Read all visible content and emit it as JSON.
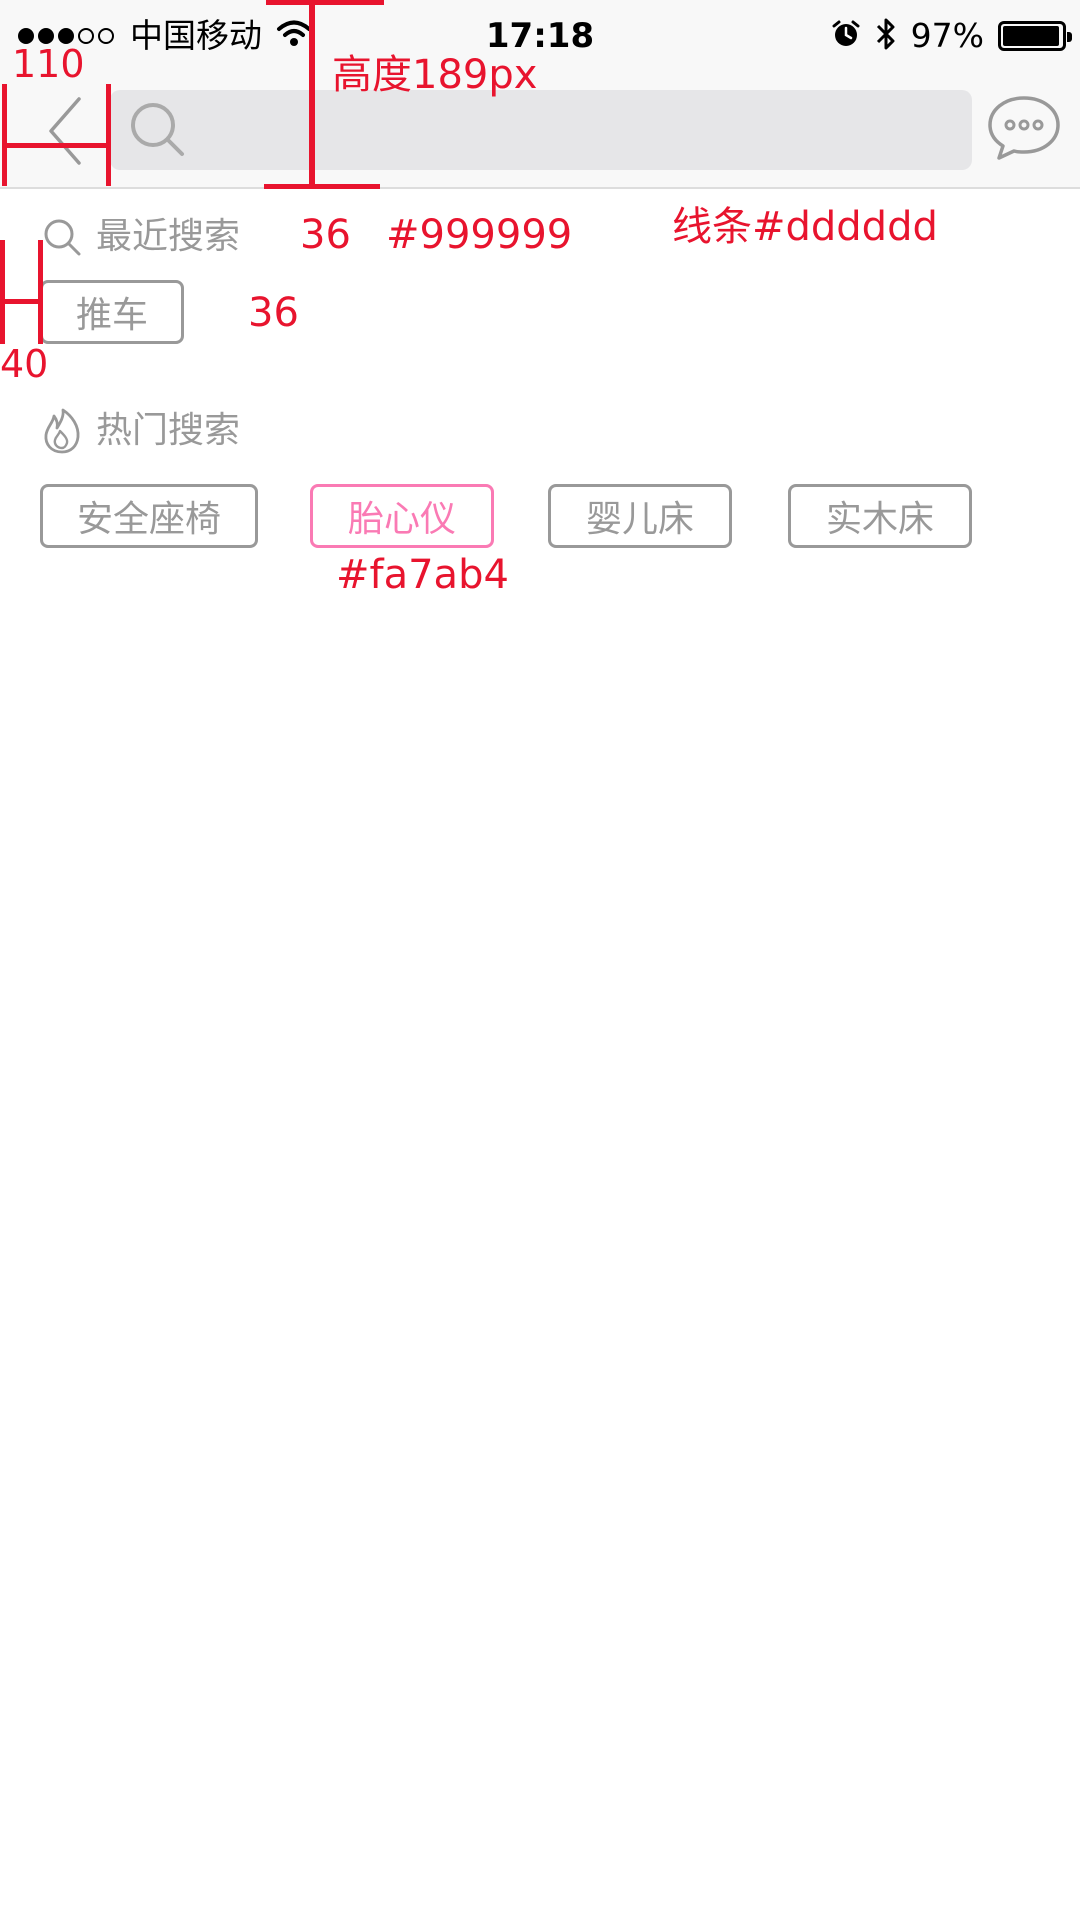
{
  "status_bar": {
    "carrier": "中国移动",
    "time": "17:18",
    "battery_percent": "97%",
    "battery_level": 0.97,
    "icons": [
      "signal-dots-icon",
      "wifi-icon",
      "alarm-icon",
      "bluetooth-icon",
      "battery-icon"
    ]
  },
  "header": {
    "icons": [
      "back-arrow-icon",
      "search-icon",
      "message-bubble-icon"
    ],
    "search_placeholder": ""
  },
  "recent": {
    "title": "最近搜索",
    "icon": "search-icon",
    "tags": [
      "推车"
    ]
  },
  "hot": {
    "title": "热门搜索",
    "icon": "flame-icon",
    "tags": [
      "安全座椅",
      "胎心仪",
      "婴儿床",
      "实木床"
    ],
    "active_tag": "胎心仪"
  },
  "annotations": {
    "back_width": "110",
    "header_height": "高度189px",
    "font_size_title": "36",
    "text_color": "#999999",
    "line_color": "线条#dddddd",
    "left_margin": "40",
    "font_size_tag": "36",
    "active_color": "#fa7ab4"
  },
  "colors": {
    "text": "#999999",
    "line": "#dddddd",
    "accent": "#fa7ab4",
    "annotation": "#e8142e"
  }
}
